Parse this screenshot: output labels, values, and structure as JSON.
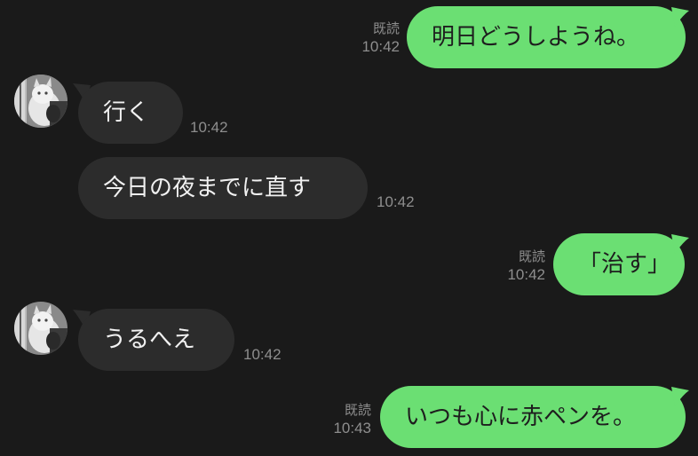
{
  "colors": {
    "background": "#1a1a1a",
    "outgoing_bubble": "#6bdf73",
    "incoming_bubble": "#2c2c2c",
    "meta_text": "#8e8e8e"
  },
  "messages": [
    {
      "direction": "outgoing",
      "text": "明日どうしようね。",
      "read_label": "既読",
      "time": "10:42"
    },
    {
      "direction": "incoming",
      "text": "行く",
      "time": "10:42",
      "avatar": "cat-avatar"
    },
    {
      "direction": "incoming",
      "text": "今日の夜までに直す",
      "time": "10:42"
    },
    {
      "direction": "outgoing",
      "text": "「治す」",
      "read_label": "既読",
      "time": "10:42"
    },
    {
      "direction": "incoming",
      "text": "うるへえ",
      "time": "10:42",
      "avatar": "cat-avatar"
    },
    {
      "direction": "outgoing",
      "text": "いつも心に赤ペンを。",
      "read_label": "既読",
      "time": "10:43"
    }
  ]
}
